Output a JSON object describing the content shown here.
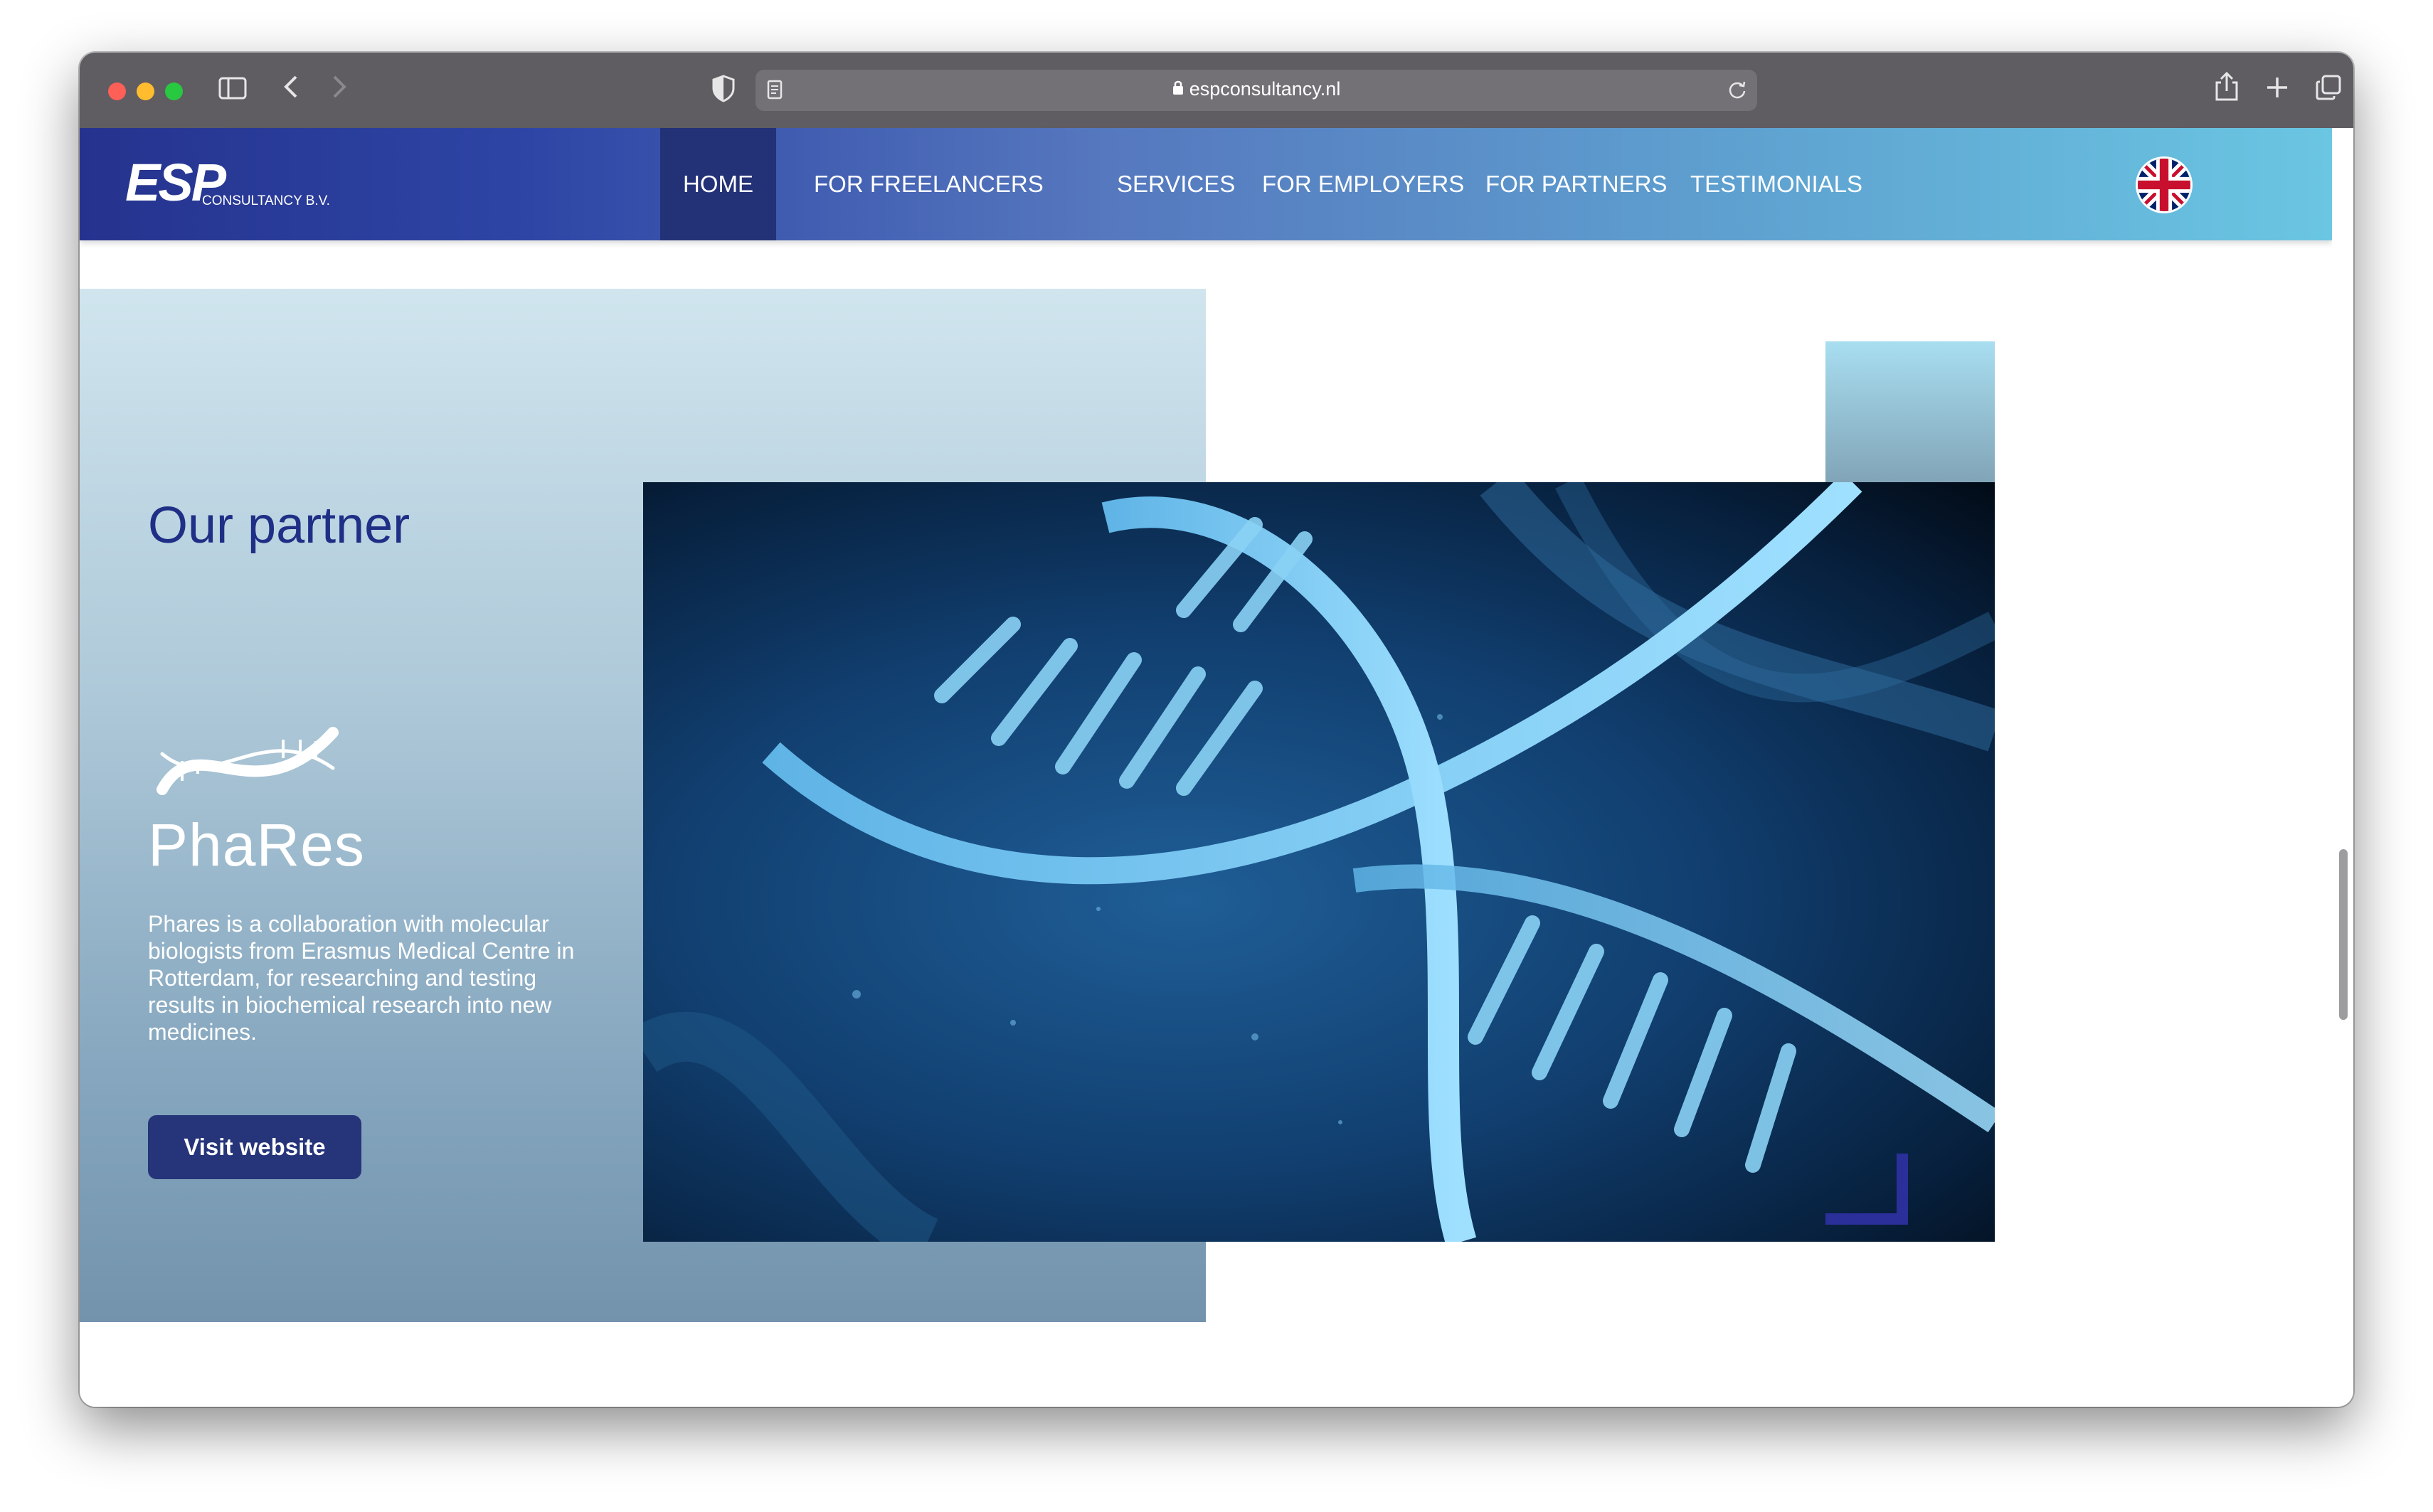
{
  "browser": {
    "url": "espconsultancy.nl"
  },
  "nav": {
    "logo_main": "ESP",
    "logo_sub": "CONSULTANCY B.V.",
    "items": [
      "HOME",
      "FOR FREELANCERS",
      "SERVICES",
      "FOR EMPLOYERS",
      "FOR PARTNERS",
      "TESTIMONIALS"
    ],
    "active": "HOME",
    "language_flag": "uk-flag-icon"
  },
  "partner": {
    "title": "Our partner",
    "logo_text": "PhaRes",
    "description": "Phares is a collaboration with molecular biologists from Erasmus Medical Centre in Rotterdam, for researching and testing results in biochemical research into new medicines.",
    "button_label": "Visit website",
    "image": "dna-helix-image"
  },
  "colors": {
    "nav_start": "#25338e",
    "nav_end": "#6ac6e2",
    "title": "#1f2f86",
    "button": "#263479"
  }
}
